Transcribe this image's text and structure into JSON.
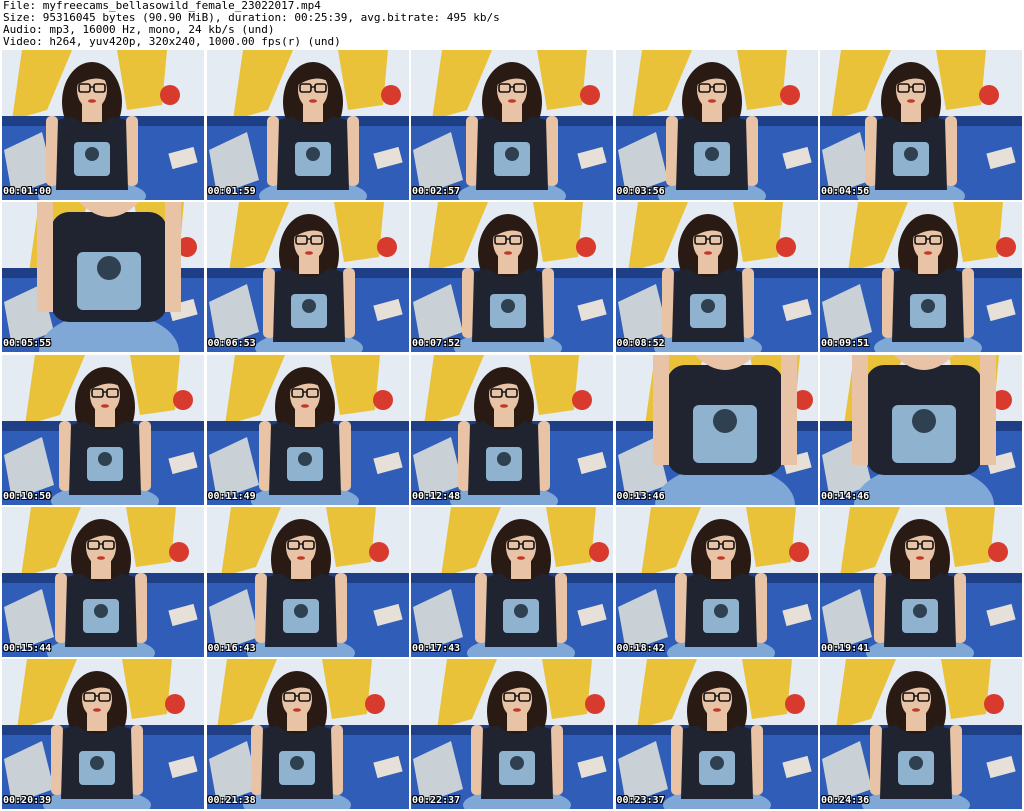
{
  "header": {
    "file_line": "File: myfreecams_bellasowild_female_23022017.mp4",
    "size_line": "Size: 95316045 bytes (90.90 MiB), duration: 00:25:39, avg.bitrate: 495 kb/s",
    "audio_line": "Audio: mp3, 16000 Hz, mono, 24 kb/s (und)",
    "video_line": "Video: h264, yuv420p, 320x240, 1000.00 fps(r) (und)"
  },
  "thumbnails": [
    {
      "timestamp": "00:01:00",
      "pose": "normal"
    },
    {
      "timestamp": "00:01:59",
      "pose": "normal"
    },
    {
      "timestamp": "00:02:57",
      "pose": "normal"
    },
    {
      "timestamp": "00:03:56",
      "pose": "normal"
    },
    {
      "timestamp": "00:04:56",
      "pose": "normal"
    },
    {
      "timestamp": "00:05:55",
      "pose": "close"
    },
    {
      "timestamp": "00:06:53",
      "pose": "normal"
    },
    {
      "timestamp": "00:07:52",
      "pose": "normal"
    },
    {
      "timestamp": "00:08:52",
      "pose": "normal"
    },
    {
      "timestamp": "00:09:51",
      "pose": "normal"
    },
    {
      "timestamp": "00:10:50",
      "pose": "normal"
    },
    {
      "timestamp": "00:11:49",
      "pose": "normal"
    },
    {
      "timestamp": "00:12:48",
      "pose": "normal"
    },
    {
      "timestamp": "00:13:46",
      "pose": "close"
    },
    {
      "timestamp": "00:14:46",
      "pose": "close"
    },
    {
      "timestamp": "00:15:44",
      "pose": "normal"
    },
    {
      "timestamp": "00:16:43",
      "pose": "normal"
    },
    {
      "timestamp": "00:17:43",
      "pose": "normal"
    },
    {
      "timestamp": "00:18:42",
      "pose": "normal"
    },
    {
      "timestamp": "00:19:41",
      "pose": "normal"
    },
    {
      "timestamp": "00:20:39",
      "pose": "normal"
    },
    {
      "timestamp": "00:21:38",
      "pose": "normal"
    },
    {
      "timestamp": "00:22:37",
      "pose": "normal"
    },
    {
      "timestamp": "00:23:37",
      "pose": "normal"
    },
    {
      "timestamp": "00:24:36",
      "pose": "normal"
    }
  ],
  "colors": {
    "wall": "#e4ebf3",
    "sofa": "#2f5db8",
    "sofa_dark": "#1e3f86",
    "pillow": "#c9d0d6",
    "skin": "#e8c3a6",
    "hair": "#2a1a14",
    "top": "#1f2430",
    "print": "#8fb2cf",
    "shorts": "#7fa8d6",
    "art_yellow": "#e9c23a",
    "art_red": "#d83a2e",
    "shelf": "#f2f2f2"
  }
}
